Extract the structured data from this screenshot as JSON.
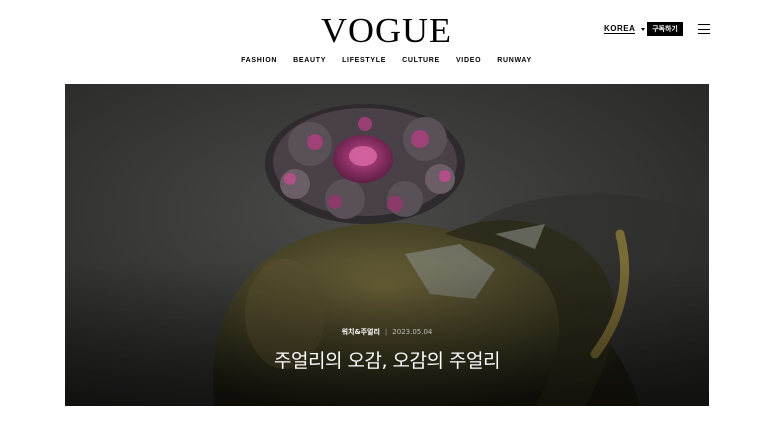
{
  "header": {
    "logo": "VOGUE",
    "edition": "KOREA",
    "subscribe_label": "구독하기"
  },
  "nav": [
    {
      "label": "FASHION"
    },
    {
      "label": "BEAUTY"
    },
    {
      "label": "LIFESTYLE"
    },
    {
      "label": "CULTURE"
    },
    {
      "label": "VIDEO"
    },
    {
      "label": "RUNWAY"
    }
  ],
  "hero": {
    "category": "워치&주얼리",
    "date": "2023.05.04",
    "title": "주얼리의 오감, 오감의 주얼리"
  },
  "colors": {
    "background": "#ffffff",
    "text": "#000000",
    "hero_bg": "#3b3b3a"
  }
}
